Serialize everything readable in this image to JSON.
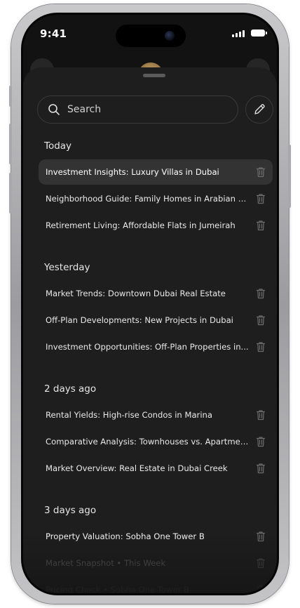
{
  "status_bar": {
    "time": "9:41"
  },
  "search": {
    "placeholder": "Search"
  },
  "sections": [
    {
      "label": "Today",
      "items": [
        "Investment Insights: Luxury Villas in Dubai",
        "Neighborhood Guide: Family Homes in Arabian R...",
        "Retirement Living: Affordable Flats in Jumeirah"
      ]
    },
    {
      "label": "Yesterday",
      "items": [
        "Market Trends: Downtown Dubai Real Estate",
        "Off-Plan Developments: New Projects in Dubai",
        "Investment Opportunities: Off-Plan Properties in..."
      ]
    },
    {
      "label": "2 days ago",
      "items": [
        "Rental Yields: High-rise Condos in Marina",
        "Comparative Analysis: Townhouses vs. Apartmen...",
        "Market Overview: Real Estate in Dubai Creek"
      ]
    },
    {
      "label": "3 days ago",
      "items": [
        "Property Valuation: Sobha One Tower B",
        "Market Snapshot  •  This Week",
        "Pricing Check  •  Sobha One Tower B"
      ]
    }
  ],
  "colors": {
    "sheet_background": "#1e1e1e",
    "active_row": "#333333",
    "text": "#e9e9e9"
  }
}
